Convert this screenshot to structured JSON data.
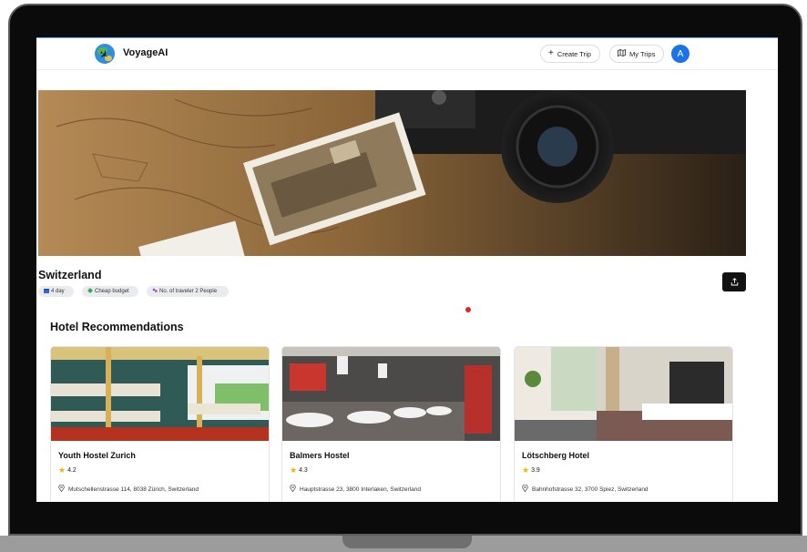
{
  "header": {
    "brand": "VoyageAI",
    "create_trip_label": "Create Trip",
    "my_trips_label": "My Trips",
    "avatar_letter": "A"
  },
  "trip": {
    "destination": "Switzerland",
    "duration": "4 day",
    "budget": "Cheap budget",
    "travelers": "No. of traveler 2 People"
  },
  "hotels": {
    "section_title": "Hotel Recommendations",
    "items": [
      {
        "name": "Youth Hostel Zurich",
        "rating": "4.2",
        "address": "Mutschellenstrasse 114, 8038 Zürich, Switzerland"
      },
      {
        "name": "Balmers Hostel",
        "rating": "4.3",
        "address": "Hauptstrasse 23, 3800 Interlaken, Switzerland"
      },
      {
        "name": "Lötschberg Hotel",
        "rating": "3.9",
        "address": "Bahnhofstrasse 32, 3700 Spiez, Switzerland"
      }
    ]
  },
  "icons": {
    "plus": "plus-icon",
    "map": "map-icon",
    "share": "share-icon",
    "star": "star-icon",
    "location": "location-pin-icon",
    "calendar": "calendar-icon",
    "money": "money-icon",
    "travelers": "travelers-icon"
  },
  "colors": {
    "accent": "#1a73e8",
    "active_dot": "#e02424",
    "star": "#f5b400",
    "share_button": "#111111"
  }
}
